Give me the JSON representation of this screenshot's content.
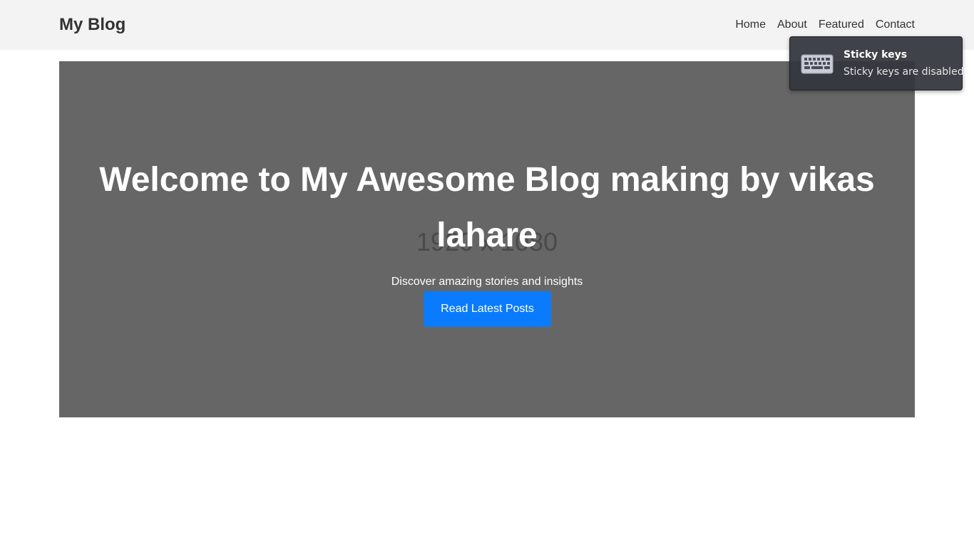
{
  "header": {
    "brand": "My Blog",
    "nav": [
      "Home",
      "About",
      "Featured",
      "Contact"
    ]
  },
  "hero": {
    "placeholder_label": "1920 x 1080",
    "title": "Welcome to My Awesome Blog making by vikas lahare",
    "subtitle": "Discover amazing stories and insights",
    "button_label": "Read Latest Posts"
  },
  "notification": {
    "icon": "keyboard-icon",
    "title": "Sticky keys",
    "body": "Sticky keys are disabled"
  },
  "colors": {
    "header_bg": "#f3f3f3",
    "hero_bg": "#666666",
    "button_bg": "#0b7bfe",
    "toast_bg": "#34363e"
  }
}
